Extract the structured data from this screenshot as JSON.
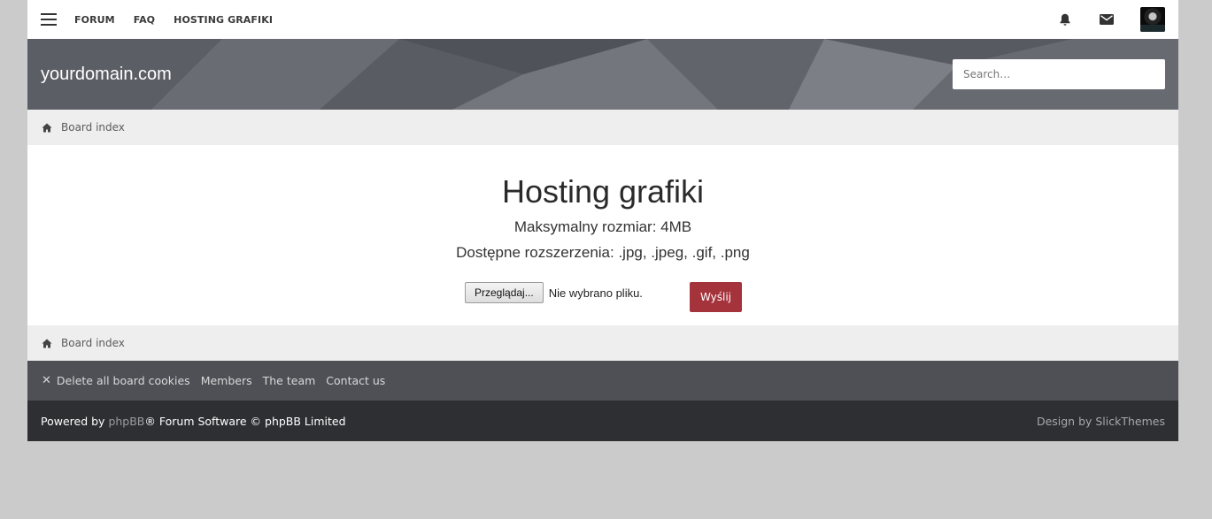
{
  "topnav": {
    "links": [
      "FORUM",
      "FAQ",
      "HOSTING GRAFIKI"
    ]
  },
  "header": {
    "site_name": "yourdomain.com",
    "search_placeholder": "Search…"
  },
  "breadcrumb": {
    "label": "Board index"
  },
  "main": {
    "title": "Hosting grafiki",
    "max_size": "Maksymalny rozmiar: 4MB",
    "extensions": "Dostępne rozszerzenia: .jpg, .jpeg, .gif, .png",
    "browse_label": "Przeglądaj...",
    "file_status": "Nie wybrano pliku.",
    "send_label": "Wyślij"
  },
  "linkbar": {
    "delete_cookies": "Delete all board cookies",
    "members": "Members",
    "team": "The team",
    "contact": "Contact us"
  },
  "footer": {
    "powered_prefix": "Powered by ",
    "phpbb": "phpBB",
    "powered_suffix": "® Forum Software © phpBB Limited",
    "design": "Design by SlickThemes"
  },
  "colors": {
    "accent": "#a5333b",
    "page_bg": "#cbcbcb",
    "footer_bg": "#2d2f33",
    "linkbar_bg": "#4e5055",
    "crumb_bg": "#eeeeee"
  },
  "icons": {
    "menu": "hamburger-icon",
    "notifications": "bell-icon",
    "messages": "envelope-icon",
    "home": "home-icon",
    "delete": "close-icon"
  }
}
